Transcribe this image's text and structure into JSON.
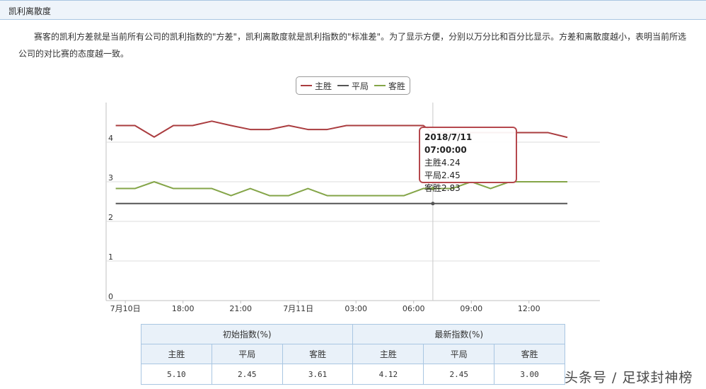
{
  "header": {
    "title": "凯利离散度"
  },
  "description": "赛客的凯利方差就是当前所有公司的凯利指数的\"方差\"，凯利离散度就是凯利指数的\"标准差\"。为了显示方便，分别以万分比和百分比显示。方差和离散度越小，表明当前所选公司的对比赛的态度越一致。",
  "chart_data": {
    "type": "line",
    "title": "",
    "xlabel": "",
    "ylabel": "",
    "ylim": [
      0,
      5.0
    ],
    "y_ticks": [
      "0",
      "1",
      "2",
      "3",
      "4"
    ],
    "x_ticks": [
      "7月10日",
      "18:00",
      "21:00",
      "7月11日",
      "03:00",
      "06:00",
      "09:00",
      "12:00"
    ],
    "x": [
      "7/10 14:30",
      "7/10 15:30",
      "7/10 16:30",
      "7/10 17:30",
      "7/10 18:30",
      "7/10 19:30",
      "7/10 20:30",
      "7/10 21:30",
      "7/10 22:30",
      "7/10 23:30",
      "7/11 00:30",
      "7/11 01:30",
      "7/11 02:30",
      "7/11 03:30",
      "7/11 04:30",
      "7/11 05:30",
      "7/11 06:30",
      "7/11 07:00",
      "7/11 08:00",
      "7/11 09:00",
      "7/11 10:00",
      "7/11 11:00",
      "7/11 12:00",
      "7/11 13:00",
      "7/11 14:00"
    ],
    "x_hours": [
      0.5,
      1.5,
      2.5,
      3.5,
      4.5,
      5.5,
      6.5,
      7.5,
      8.5,
      9.5,
      10.5,
      11.5,
      12.5,
      13.5,
      14.5,
      15.5,
      16.5,
      17.0,
      18.0,
      19.0,
      20.0,
      21.0,
      22.0,
      23.0,
      24.0
    ],
    "series": [
      {
        "name": "主胜",
        "color": "#aa3c3f",
        "values": [
          4.42,
          4.42,
          4.13,
          4.42,
          4.42,
          4.53,
          4.42,
          4.32,
          4.32,
          4.42,
          4.32,
          4.32,
          4.42,
          4.42,
          4.42,
          4.42,
          4.42,
          4.24,
          4.24,
          4.24,
          4.24,
          4.24,
          4.24,
          4.24,
          4.12
        ]
      },
      {
        "name": "平局",
        "color": "#555555",
        "values": [
          2.45,
          2.45,
          2.45,
          2.45,
          2.45,
          2.45,
          2.45,
          2.45,
          2.45,
          2.45,
          2.45,
          2.45,
          2.45,
          2.45,
          2.45,
          2.45,
          2.45,
          2.45,
          2.45,
          2.45,
          2.45,
          2.45,
          2.45,
          2.45,
          2.45
        ]
      },
      {
        "name": "客胜",
        "color": "#84a548",
        "values": [
          2.83,
          2.83,
          3.0,
          2.83,
          2.83,
          2.83,
          2.65,
          2.83,
          2.65,
          2.65,
          2.83,
          2.65,
          2.65,
          2.65,
          2.65,
          2.65,
          2.83,
          2.83,
          2.83,
          3.0,
          2.83,
          3.0,
          3.0,
          3.0,
          3.0
        ]
      }
    ],
    "grid": true,
    "legend": "top-center",
    "tooltip": {
      "index": 17,
      "date": "2018/7/11 07:00:00",
      "lines": [
        "主胜4.24",
        "平局2.45",
        "客胜2.83"
      ]
    }
  },
  "table": {
    "group_initial": "初始指数(%)",
    "group_latest": "最新指数(%)",
    "columns": [
      "主胜",
      "平局",
      "客胜",
      "主胜",
      "平局",
      "客胜"
    ],
    "values": [
      "5.10",
      "2.45",
      "3.61",
      "4.12",
      "2.45",
      "3.00"
    ]
  },
  "watermark": "头条号 / 足球封神榜"
}
